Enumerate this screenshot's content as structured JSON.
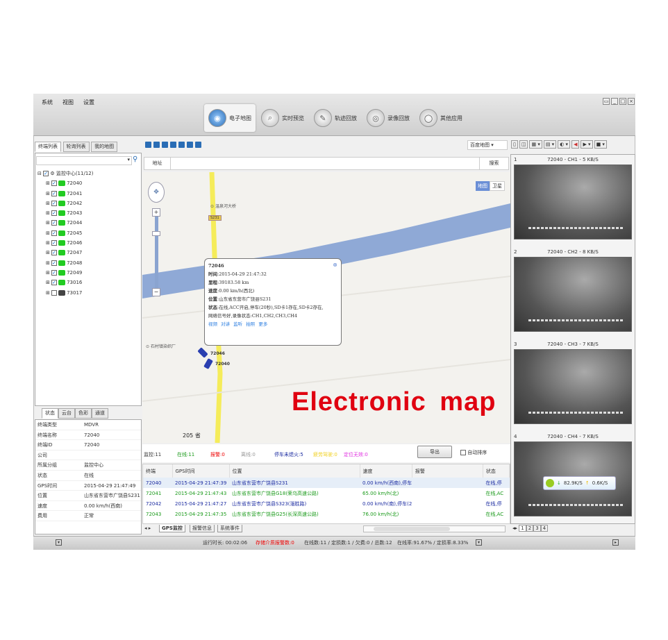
{
  "menu": [
    "系统",
    "视图",
    "设置"
  ],
  "nav": [
    {
      "label": "电子地图",
      "icon": "globe-icon",
      "active": true
    },
    {
      "label": "实时预览",
      "icon": "camera-icon"
    },
    {
      "label": "轨迹回放",
      "icon": "track-icon"
    },
    {
      "label": "录像回放",
      "icon": "record-icon"
    },
    {
      "label": "其他应用",
      "icon": "apps-icon"
    }
  ],
  "left": {
    "tabs": [
      "终端列表",
      "轮询列表",
      "我的地图"
    ],
    "tree_root": "监控中心(11/12)",
    "vehicles": [
      "72040",
      "72041",
      "72042",
      "72043",
      "72044",
      "72045",
      "72046",
      "72047",
      "72048",
      "72049",
      "73016",
      "73017"
    ],
    "prop_tabs": [
      "状态",
      "云台",
      "色彩",
      "通道"
    ],
    "props": [
      [
        "终端类型",
        "MDVR"
      ],
      [
        "终端名称",
        "72040"
      ],
      [
        "终端ID",
        "72040"
      ],
      [
        "公司",
        ""
      ],
      [
        "所属分组",
        "监控中心"
      ],
      [
        "状态",
        "在线"
      ],
      [
        "GPS时间",
        "2015-04-29 21:47:49"
      ],
      [
        "位置",
        "山东省东营市广饶县S231"
      ],
      [
        "速度",
        "0.00 km/h(西南)"
      ],
      [
        "费用",
        "正常"
      ]
    ]
  },
  "map": {
    "provider": "百度地图",
    "address_label": "地址",
    "search": "搜索",
    "type_map": "地图",
    "type_sat": "卫星",
    "poi1": "温泉河大桥",
    "poi2": "石村镇染织厂",
    "road_label": "S231",
    "bottom_label": "205 省",
    "popup": {
      "id": "72046",
      "time_label": "时间",
      "time": ":2015-04-29 21:47:32",
      "mileage_label": "里程",
      "mileage": ":39183.58 km",
      "speed_label": "速度",
      "speed": ":0.00 km/h(西北)",
      "pos_label": "位置",
      "pos": ":山东省东营市广饶县S231",
      "status_label": "状态",
      "status": ":在线,ACC开启,停车(20秒),SD卡1存在,SD卡2存在,",
      "status2": "网络信号好,录像状态:CH1,CH2,CH3,CH4",
      "links": [
        "视频",
        "对讲",
        "监听",
        "拍照",
        "更多"
      ]
    },
    "markers": [
      "72046",
      "72040"
    ],
    "overlay": "Electronic map"
  },
  "stats": {
    "monitor": "监控:11",
    "online": "在线:11",
    "alarm": "报警:0",
    "offline": "离线:0",
    "parking": "停车未熄火:5",
    "yellow": "疲劳驾驶:0",
    "pink": "定位无效:0",
    "export": "导出",
    "auto_sort": "自动排序"
  },
  "table": {
    "headers": [
      "终端",
      "GPS时间",
      "位置",
      "速度",
      "报警",
      "状态"
    ],
    "rows": [
      [
        "72040",
        "2015-04-29 21:47:39",
        "山东省东营市广饶县S231",
        "0.00 km/h(西南),停车",
        "",
        "在线,停"
      ],
      [
        "72041",
        "2015-04-29 21:47:43",
        "山东省东营市广饶县G18(荣乌高速公路)",
        "65.00 km/h(北)",
        "",
        "在线,AC"
      ],
      [
        "72042",
        "2015-04-29 21:47:27",
        "山东省东营市广饶县S323(淄胜路)",
        "0.00 km/h(南),停车(2",
        "",
        "在线,停"
      ],
      [
        "72043",
        "2015-04-29 21:47:35",
        "山东省东营市广饶县G25(长深高速公路)",
        "76.00 km/h(北)",
        "",
        "在线,AC"
      ]
    ],
    "tabs": [
      "GPS监控",
      "报警信息",
      "系统事件"
    ]
  },
  "videos": [
    {
      "n": "1",
      "label": "72040 - CH1 - 5 KB/S"
    },
    {
      "n": "2",
      "label": "72040 - CH2 - 8 KB/S"
    },
    {
      "n": "3",
      "label": "72040 - CH3 - 7 KB/S"
    },
    {
      "n": "4",
      "label": "72040 - CH4 - 7 KB/S"
    }
  ],
  "net": {
    "down": "82.9K/S",
    "up": "0.6K/S"
  },
  "video_pages": [
    "1",
    "2",
    "3",
    "4"
  ],
  "status": {
    "runtime": "运行时长: 00:02:06",
    "alarm": "存储介质报警数:0",
    "counts": "在线数:11 / 定损数:1 / 欠费:0 / 总数:12",
    "rate": "在线率:91.67% / 定损率:8.33%"
  },
  "colors": {
    "online": "#1a9a1a",
    "alarm": "#e00",
    "blue": "#1a2aa0",
    "overlay": "#e00010",
    "river": "#8fa9d6",
    "road": "#f5ec5a"
  }
}
